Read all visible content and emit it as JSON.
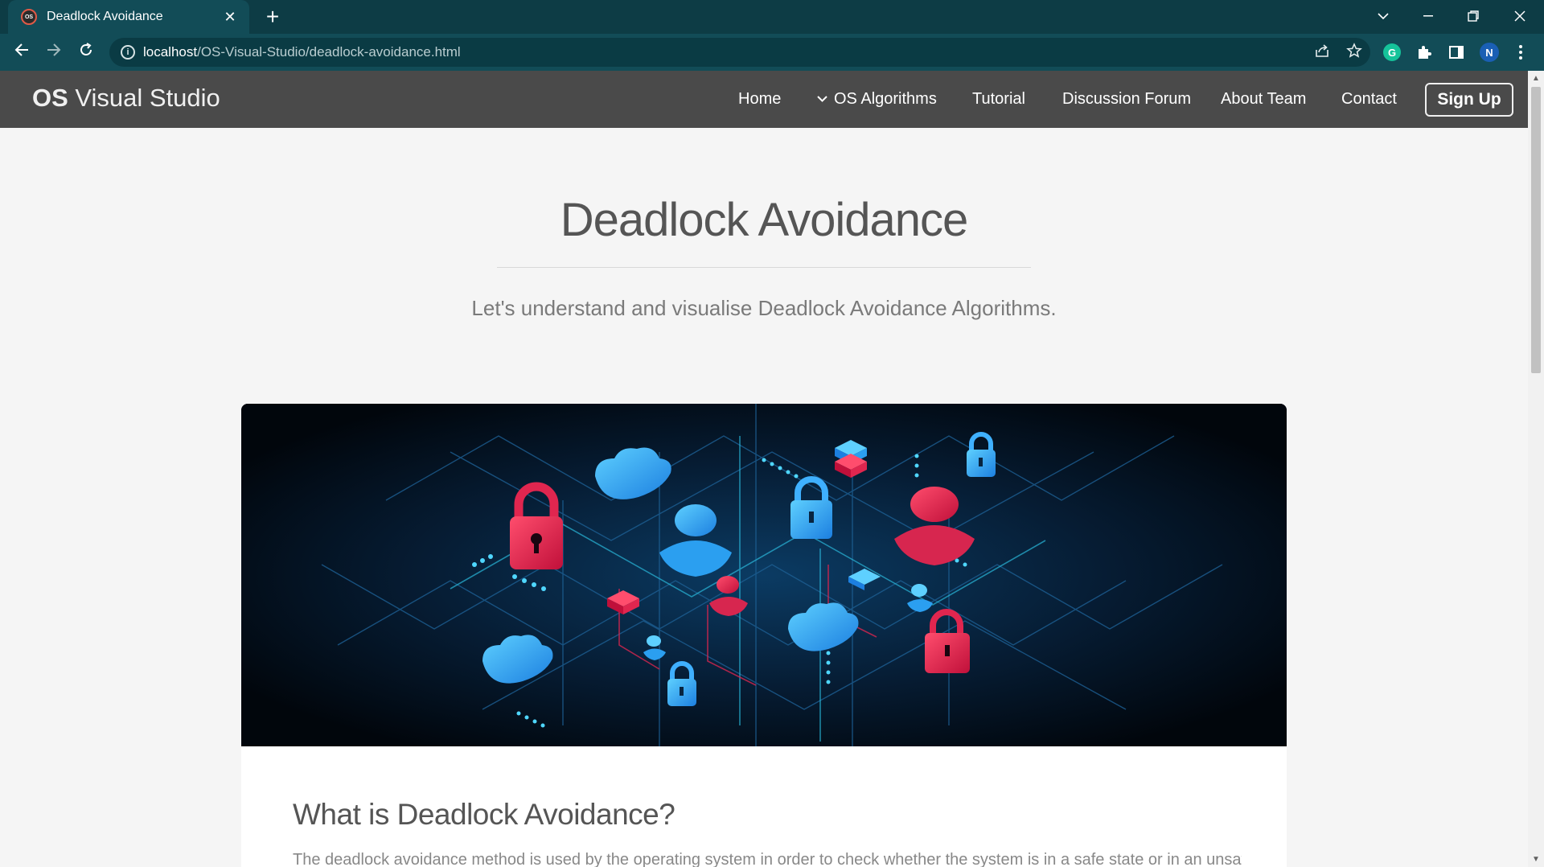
{
  "browser": {
    "tab_title": "Deadlock Avoidance",
    "favicon_text": "OS",
    "url_host": "localhost",
    "url_path": "/OS-Visual-Studio/deadlock-avoidance.html",
    "profile_initial": "N",
    "tab_bg": "#124c57",
    "frame_bg": "#0d3c45"
  },
  "site": {
    "brand_bold": "OS",
    "brand_rest": " Visual Studio",
    "nav": {
      "home": "Home",
      "algorithms": "OS Algorithms",
      "tutorial": "Tutorial",
      "forum": "Discussion Forum",
      "about": "About Team",
      "contact": "Contact",
      "signup": "Sign Up"
    },
    "navbar_bg": "#4a4a4a"
  },
  "hero": {
    "title": "Deadlock Avoidance",
    "subtitle": "Let's understand and visualise Deadlock Avoidance Algorithms."
  },
  "content": {
    "section_title": "What is Deadlock Avoidance?",
    "section_text": "The deadlock avoidance method is used by the operating system in order to check whether the system is in a safe state or in an unsafe state"
  },
  "icons": {
    "back": "back-arrow-icon",
    "forward": "forward-arrow-icon",
    "reload": "reload-icon",
    "share": "share-icon",
    "star": "bookmark-star-icon",
    "lock": "padlock-icon",
    "cloud": "cloud-icon",
    "user": "user-icon"
  }
}
